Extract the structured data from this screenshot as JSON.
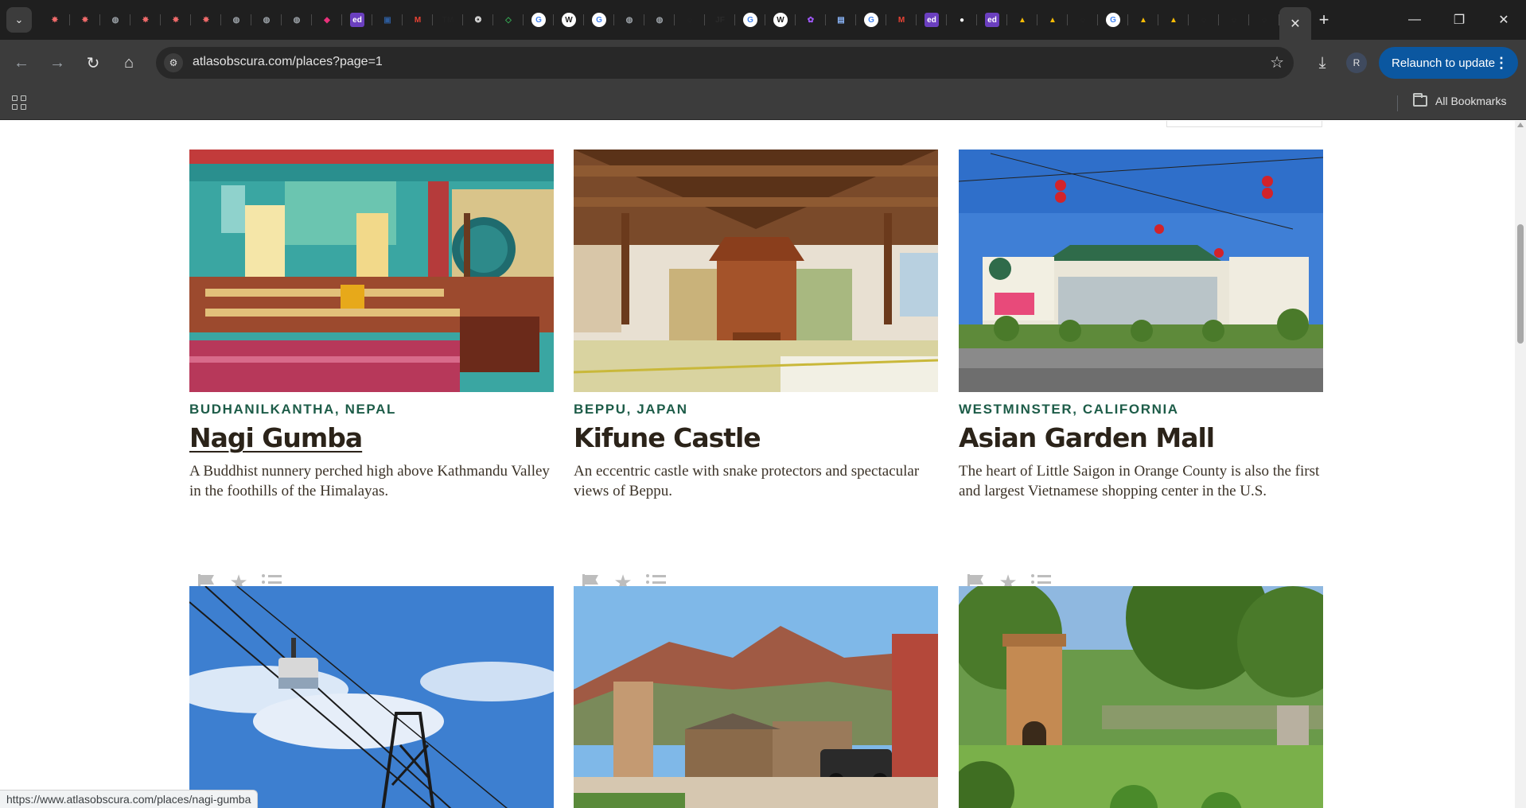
{
  "browser": {
    "tabs": [
      {
        "icon": "asana-icon",
        "color": "#f06a6a",
        "glyph": "✸"
      },
      {
        "icon": "asana-icon",
        "color": "#f06a6a",
        "glyph": "✸"
      },
      {
        "icon": "globe-icon",
        "color": "#9aa0a6",
        "glyph": "◍"
      },
      {
        "icon": "asana-icon",
        "color": "#f06a6a",
        "glyph": "✸"
      },
      {
        "icon": "asana-icon",
        "color": "#f06a6a",
        "glyph": "✸"
      },
      {
        "icon": "asana-icon",
        "color": "#f06a6a",
        "glyph": "✸"
      },
      {
        "icon": "globe-icon",
        "color": "#9aa0a6",
        "glyph": "◍"
      },
      {
        "icon": "globe-icon",
        "color": "#9aa0a6",
        "glyph": "◍"
      },
      {
        "icon": "globe-icon",
        "color": "#9aa0a6",
        "glyph": "◍"
      },
      {
        "icon": "cube-icon",
        "color": "#e8317a",
        "glyph": "◆"
      },
      {
        "icon": "edstem-icon",
        "color": "#6b3fbf",
        "glyph": "ed"
      },
      {
        "icon": "shield-icon",
        "color": "#2d5b9a",
        "glyph": "▣"
      },
      {
        "icon": "gmail-icon",
        "color": "#ea4335",
        "glyph": "M"
      },
      {
        "icon": "tm-icon",
        "color": "#222222",
        "glyph": "TM"
      },
      {
        "icon": "openai-icon",
        "color": "#e3e3e3",
        "glyph": "❂"
      },
      {
        "icon": "diamond-icon",
        "color": "#34a853",
        "glyph": "◇"
      },
      {
        "icon": "google-icon",
        "color": "#ffffff",
        "glyph": "G"
      },
      {
        "icon": "wikipedia-icon",
        "color": "#ffffff",
        "glyph": "W"
      },
      {
        "icon": "google-icon",
        "color": "#ffffff",
        "glyph": "G"
      },
      {
        "icon": "globe-icon",
        "color": "#9aa0a6",
        "glyph": "◍"
      },
      {
        "icon": "globe-icon",
        "color": "#9aa0a6",
        "glyph": "◍"
      },
      {
        "icon": "dark-circle-icon",
        "color": "#2b2b2b",
        "glyph": "◌"
      },
      {
        "icon": "jf-icon",
        "color": "#2b2b2b",
        "glyph": "JF"
      },
      {
        "icon": "google-icon",
        "color": "#ffffff",
        "glyph": "G"
      },
      {
        "icon": "wikipedia-icon",
        "color": "#ffffff",
        "glyph": "W"
      },
      {
        "icon": "figma-icon",
        "color": "#a259ff",
        "glyph": "✿"
      },
      {
        "icon": "crest-icon",
        "color": "#8ab4f8",
        "glyph": "▤"
      },
      {
        "icon": "google-icon",
        "color": "#ffffff",
        "glyph": "G"
      },
      {
        "icon": "gmail-icon",
        "color": "#ea4335",
        "glyph": "M"
      },
      {
        "icon": "edstem-icon",
        "color": "#6b3fbf",
        "glyph": "ed"
      },
      {
        "icon": "github-icon",
        "color": "#ffffff",
        "glyph": "●"
      },
      {
        "icon": "edstem-icon",
        "color": "#6b3fbf",
        "glyph": "ed"
      },
      {
        "icon": "drive-icon",
        "color": "#fbbc04",
        "glyph": "▲"
      },
      {
        "icon": "drive-icon",
        "color": "#fbbc04",
        "glyph": "▲"
      },
      {
        "icon": "dark-circle-icon",
        "color": "#2b2b2b",
        "glyph": "◌"
      },
      {
        "icon": "google-icon",
        "color": "#ffffff",
        "glyph": "G"
      },
      {
        "icon": "drive-icon",
        "color": "#fbbc04",
        "glyph": "▲"
      },
      {
        "icon": "drive-icon",
        "color": "#fbbc04",
        "glyph": "▲"
      },
      {
        "icon": "dark-circle-icon",
        "color": "#2b2b2b",
        "glyph": "◌"
      },
      {
        "icon": "dark-circle-icon",
        "color": "#2b2b2b",
        "glyph": "◌"
      },
      {
        "icon": "dark-circle-icon",
        "color": "#2b2b2b",
        "glyph": "◌"
      }
    ],
    "url": "atlasobscura.com/places?page=1",
    "relaunch_label": "Relaunch to update",
    "avatar_initial": "R",
    "all_bookmarks_label": "All Bookmarks",
    "status_url": "https://www.atlasobscura.com/places/nagi-gumba"
  },
  "places": [
    {
      "location": "BUDHANILKANTHA, NEPAL",
      "title": "Nagi Gumba",
      "description": "A Buddhist nunnery perched high above Kathmandu Valley in the foothills of the Himalayas.",
      "image": "monastery-interior-photo"
    },
    {
      "location": "BEPPU, JAPAN",
      "title": "Kifune Castle",
      "description": "An eccentric castle with snake protectors and spectacular views of Beppu.",
      "image": "castle-interior-photo"
    },
    {
      "location": "WESTMINSTER, CALIFORNIA",
      "title": "Asian Garden Mall",
      "description": "The heart of Little Saigon in Orange County is also the first and largest Vietnamese shopping center in the U.S.",
      "image": "mall-exterior-photo"
    },
    {
      "image": "aerial-tramway-photo"
    },
    {
      "image": "ghost-town-photo"
    },
    {
      "image": "garden-tower-photo"
    }
  ],
  "colors": {
    "location": "#1d5c48",
    "title": "#2b2319",
    "chrome_dark": "#1f1f1f",
    "toolbar": "#3c3c3c",
    "accent": "#0b57a0"
  }
}
